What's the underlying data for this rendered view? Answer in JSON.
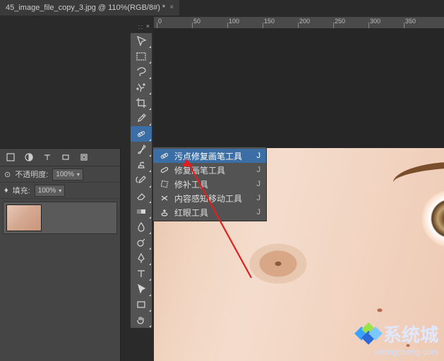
{
  "document_tab": {
    "title": "45_image_file_copy_3.jpg @ 110%(RGB/8#) *"
  },
  "ruler_marks": [
    "0",
    "50",
    "100",
    "150",
    "200",
    "250",
    "300",
    "350"
  ],
  "tools": [
    {
      "name": "move-tool"
    },
    {
      "name": "rectangular-marquee-tool"
    },
    {
      "name": "lasso-tool"
    },
    {
      "name": "quick-selection-tool"
    },
    {
      "name": "crop-tool"
    },
    {
      "name": "eyedropper-tool"
    },
    {
      "name": "spot-healing-brush-tool",
      "selected": true
    },
    {
      "name": "brush-tool"
    },
    {
      "name": "clone-stamp-tool"
    },
    {
      "name": "history-brush-tool"
    },
    {
      "name": "eraser-tool"
    },
    {
      "name": "gradient-tool"
    },
    {
      "name": "blur-tool"
    },
    {
      "name": "dodge-tool"
    },
    {
      "name": "pen-tool"
    },
    {
      "name": "horizontal-type-tool"
    },
    {
      "name": "path-selection-tool"
    },
    {
      "name": "rectangle-tool"
    },
    {
      "name": "hand-tool"
    }
  ],
  "flyout": {
    "items": [
      {
        "icon": "bandage-dots",
        "label": "污点修复画笔工具",
        "shortcut": "J",
        "selected": true
      },
      {
        "icon": "bandage",
        "label": "修复画笔工具",
        "shortcut": "J"
      },
      {
        "icon": "patch",
        "label": "修补工具",
        "shortcut": "J"
      },
      {
        "icon": "arrows-cross",
        "label": "内容感知移动工具",
        "shortcut": "J"
      },
      {
        "icon": "plus-eye",
        "label": "红眼工具",
        "shortcut": "J"
      }
    ]
  },
  "left_panel": {
    "opacity_label": "不透明度:",
    "opacity_value": "100%",
    "fill_label": "填充:",
    "fill_value": "100%"
  },
  "watermark": {
    "title": "系统城",
    "url": "xitongcheng.com"
  }
}
